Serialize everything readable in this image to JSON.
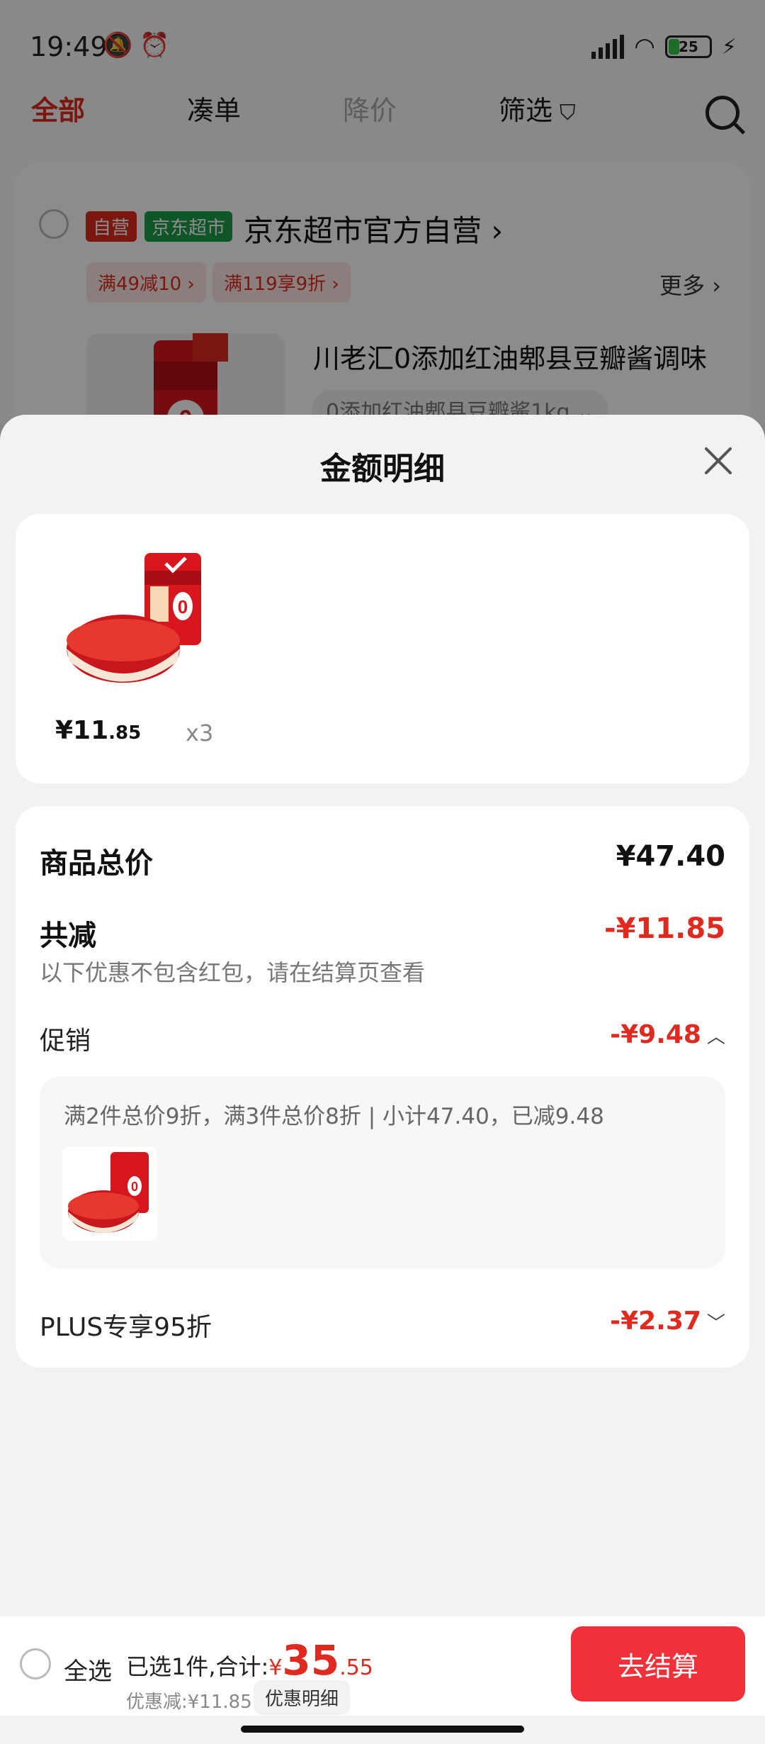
{
  "status_bar": {
    "time": "19:49",
    "battery": "25"
  },
  "tabs": [
    {
      "label": "全部"
    },
    {
      "label": "凑单"
    },
    {
      "label": "降价"
    },
    {
      "label": "筛选"
    }
  ],
  "shop": {
    "tag_self": "自营",
    "tag_jd": "京东超市",
    "name": "京东超市官方自营 ›",
    "promos": [
      "满49减10 ›",
      "满119享9折 ›"
    ],
    "more": "更多 ›",
    "product_title": "川老汇0添加红油郫县豆瓣酱调味",
    "product_spec": "0添加红油郫县豆瓣酱1kg ⌄"
  },
  "sheet": {
    "title": "金额明细",
    "item": {
      "price_int": "¥11",
      "price_dec": ".85",
      "qty": "x3"
    },
    "total_label": "商品总价",
    "total_value": "¥47.40",
    "reduce_label": "共减",
    "reduce_value": "-¥11.85",
    "reduce_note": "以下优惠不包含红包，请在结算页查看",
    "promo_label": "促销",
    "promo_value": "-¥9.48",
    "promo_detail": "满2件总价9折，满3件总价8折 | 小计47.40，已减9.48",
    "plus_label": "PLUS专享95折",
    "plus_value": "-¥2.37"
  },
  "bottom_bar": {
    "select_all": "全选",
    "summary_prefix": "已选1件,合计:",
    "total_symbol": "¥",
    "total_int": "35",
    "total_dec": ".55",
    "discount": "优惠减:¥11.85",
    "detail_button": "优惠明细",
    "checkout": "去结算"
  },
  "colors": {
    "accent": "#e02a1f",
    "checkout": "#f0313a",
    "jd_green": "#1a9b4a"
  }
}
